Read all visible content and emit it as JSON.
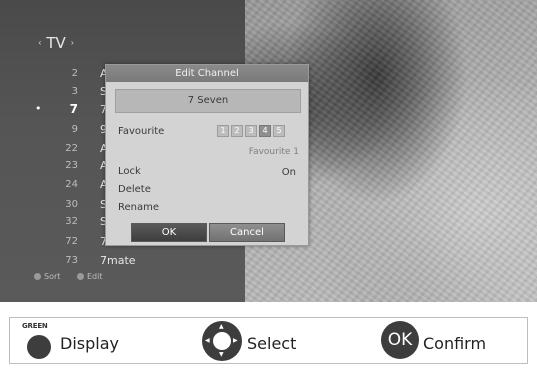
{
  "header": {
    "title": "TV",
    "arrow_left": "‹",
    "arrow_right": "›"
  },
  "channels": [
    {
      "num": "2",
      "name": "A"
    },
    {
      "num": "3",
      "name": "S"
    },
    {
      "num": "7",
      "name": "7",
      "selected": true
    },
    {
      "num": "9",
      "name": "9"
    },
    {
      "num": "22",
      "name": "A"
    },
    {
      "num": "23",
      "name": "A"
    },
    {
      "num": "24",
      "name": "A"
    },
    {
      "num": "30",
      "name": "S"
    },
    {
      "num": "32",
      "name": "S"
    },
    {
      "num": "72",
      "name": "7"
    },
    {
      "num": "73",
      "name": "7mate"
    }
  ],
  "selected_marker": "•",
  "panel_footer": {
    "sort": "Sort",
    "edit": "Edit"
  },
  "dialog": {
    "title": "Edit Channel",
    "channel": "7 Seven",
    "favourite_label": "Favourite",
    "favourite_boxes": [
      "1",
      "2",
      "3",
      "4",
      "5"
    ],
    "favourite_active": 4,
    "favourite_caption": "Favourite 1",
    "lock_label": "Lock",
    "lock_value": "On",
    "delete_label": "Delete",
    "rename_label": "Rename",
    "ok_label": "OK",
    "cancel_label": "Cancel"
  },
  "legend": {
    "green_key": "GREEN",
    "display_label": "Display",
    "select_label": "Select",
    "ok_key": "OK",
    "confirm_label": "Confirm"
  }
}
